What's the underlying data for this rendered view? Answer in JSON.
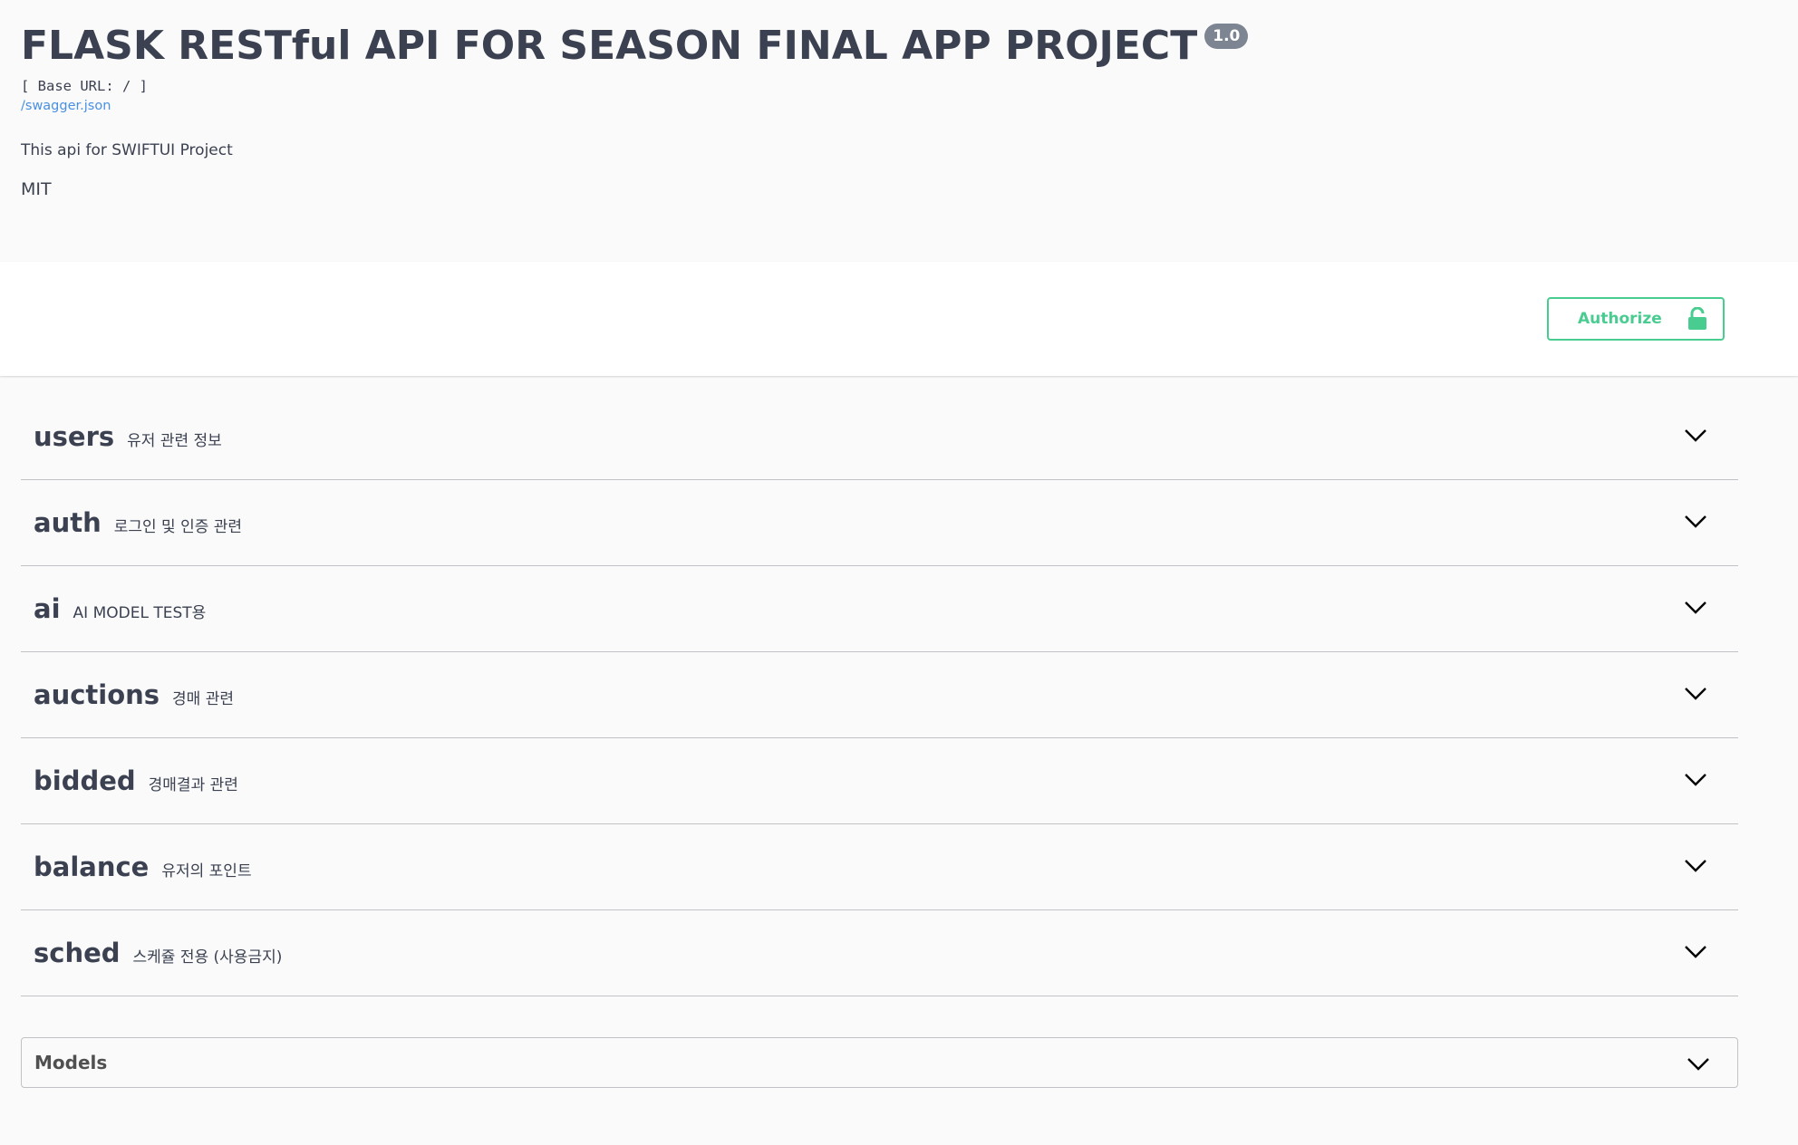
{
  "info": {
    "title": "FLASK RESTful API FOR SEASON FINAL APP PROJECT",
    "version": "1.0",
    "base_url": "[ Base URL: / ]",
    "spec_link": "/swagger.json",
    "description": "This api for SWIFTUI Project",
    "license": "MIT"
  },
  "auth": {
    "authorize_label": "Authorize",
    "icon": "unlocked-padlock-icon"
  },
  "tags": [
    {
      "name": "users",
      "description": "유저 관련 정보"
    },
    {
      "name": "auth",
      "description": "로그인 및 인증 관련"
    },
    {
      "name": "ai",
      "description": "AI MODEL TEST용"
    },
    {
      "name": "auctions",
      "description": "경매 관련"
    },
    {
      "name": "bidded",
      "description": "경매결과 관련"
    },
    {
      "name": "balance",
      "description": "유저의 포인트"
    },
    {
      "name": "sched",
      "description": "스케쥴 전용 (사용금지)"
    }
  ],
  "models": {
    "title": "Models"
  },
  "colors": {
    "text": "#3b4151",
    "accent_green": "#49cc90",
    "link": "#4990e2",
    "version_badge": "#7d8492",
    "background": "#fafafa"
  }
}
